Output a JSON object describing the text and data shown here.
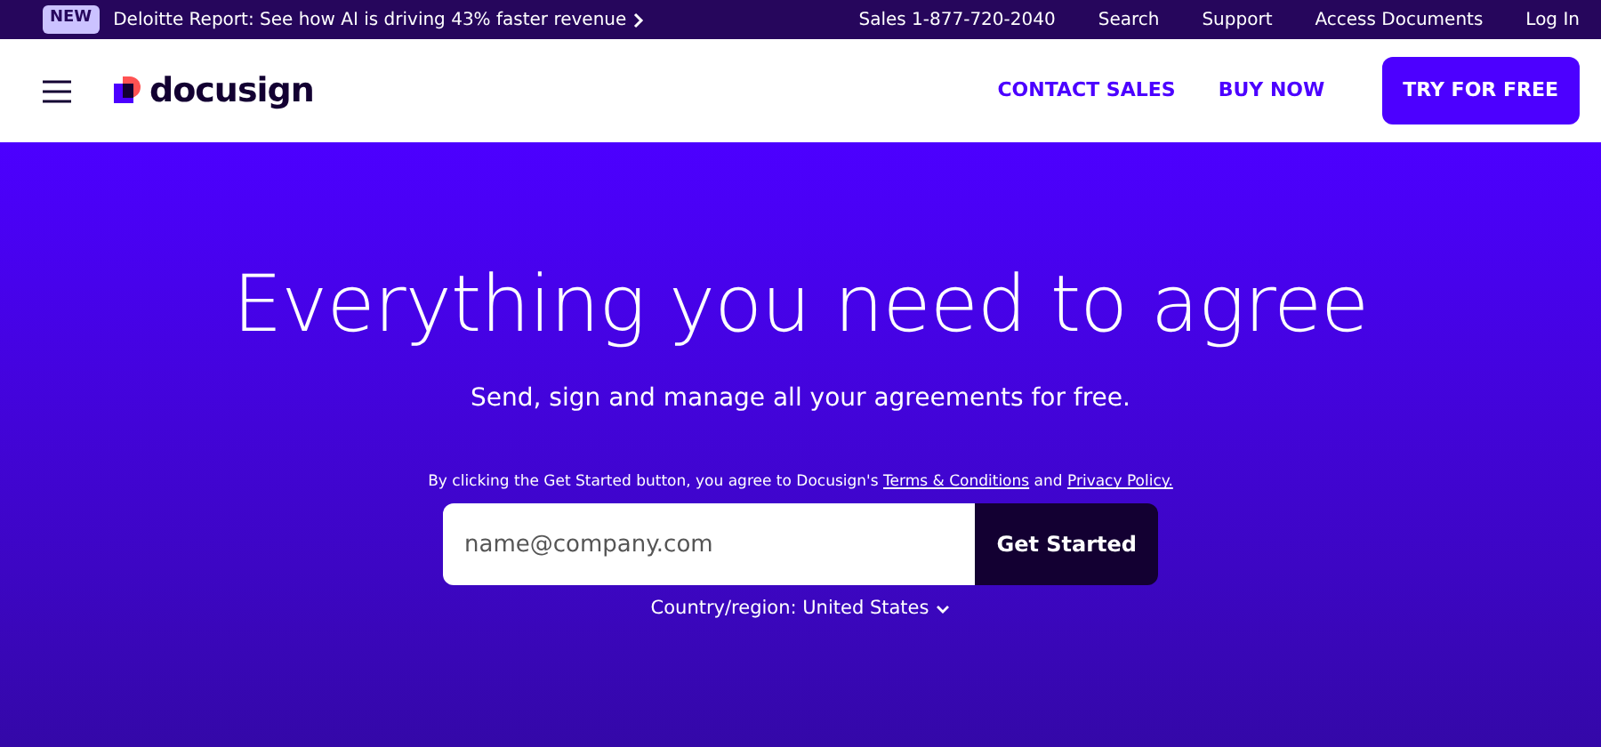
{
  "promo_bar": {
    "badge": "NEW",
    "text": "Deloitte Report: See how AI is driving 43% faster revenue",
    "links": [
      "Sales 1-877-720-2040",
      "Search",
      "Support",
      "Access Documents",
      "Log In"
    ]
  },
  "navbar": {
    "brand": "docusign",
    "links": [
      "CONTACT SALES",
      "BUY NOW"
    ],
    "cta": "TRY FOR FREE"
  },
  "hero": {
    "title": "Everything you need to agree",
    "subtitle": "Send, sign and manage all your agreements for free.",
    "consent": {
      "text_before": "By clicking the Get Started button, you agree to Docusign's ",
      "terms_link": "Terms & Conditions",
      "text_middle": " and ",
      "privacy_link": "Privacy Policy."
    },
    "email": {
      "placeholder": "name@company.com"
    },
    "submit": "Get Started",
    "region": "Country/region: United States"
  }
}
